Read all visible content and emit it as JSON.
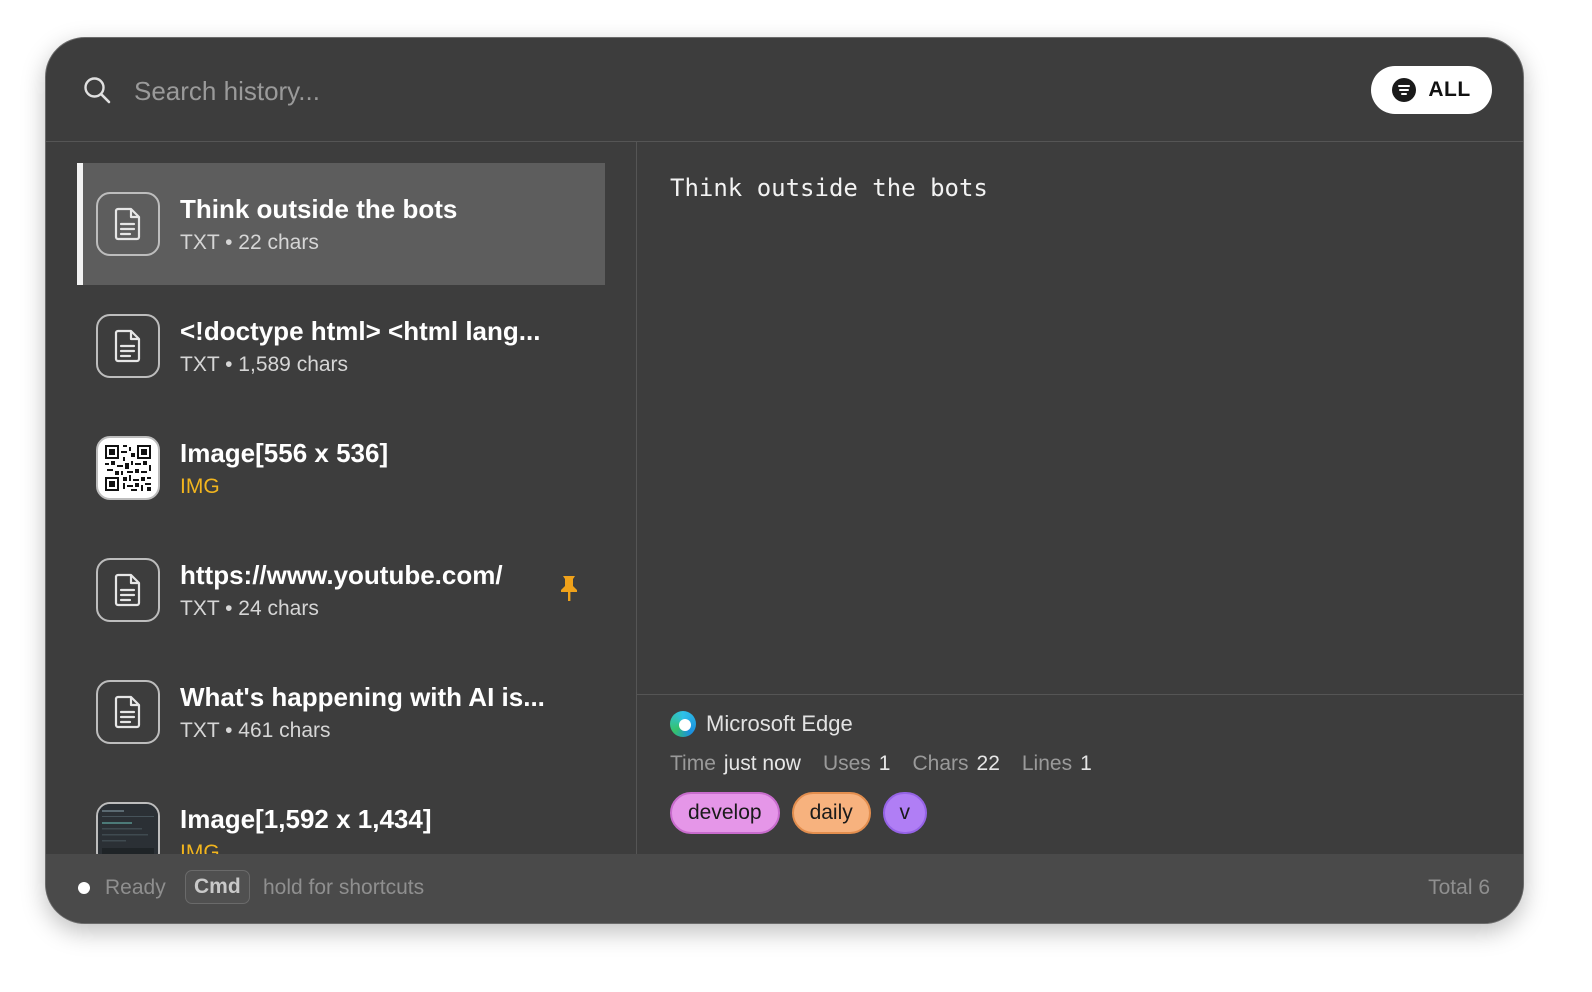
{
  "search": {
    "placeholder": "Search history..."
  },
  "filter": {
    "label": "ALL"
  },
  "items": [
    {
      "title": "Think outside the bots",
      "type": "TXT",
      "detail": "22 chars",
      "meta": "TXT • 22 chars",
      "kind": "text",
      "selected": true,
      "pinned": false
    },
    {
      "title": "<!doctype html> <html lang...",
      "type": "TXT",
      "detail": "1,589 chars",
      "meta": "TXT • 1,589 chars",
      "kind": "text",
      "selected": false,
      "pinned": false
    },
    {
      "title": "Image[556 x 536]",
      "type": "IMG",
      "meta": "IMG",
      "kind": "image-qr",
      "selected": false,
      "pinned": false
    },
    {
      "title": "https://www.youtube.com/",
      "type": "TXT",
      "detail": "24 chars",
      "meta": "TXT • 24 chars",
      "kind": "text",
      "selected": false,
      "pinned": true
    },
    {
      "title": "What's happening with AI is...",
      "type": "TXT",
      "detail": "461 chars",
      "meta": "TXT • 461 chars",
      "kind": "text",
      "selected": false,
      "pinned": false
    },
    {
      "title": "Image[1,592 x 1,434]",
      "type": "IMG",
      "meta": "IMG",
      "kind": "image-screenshot",
      "selected": false,
      "pinned": false
    }
  ],
  "preview": {
    "content": "Think outside the bots"
  },
  "details": {
    "source": "Microsoft Edge",
    "source_icon": "edge-browser-icon",
    "stats": [
      {
        "label": "Time",
        "value": "just now"
      },
      {
        "label": "Uses",
        "value": "1"
      },
      {
        "label": "Chars",
        "value": "22"
      },
      {
        "label": "Lines",
        "value": "1"
      }
    ],
    "tags": [
      {
        "label": "develop",
        "color": "#e596e8"
      },
      {
        "label": "daily",
        "color": "#f7b27e"
      },
      {
        "label": "v",
        "color": "#b07ef5"
      }
    ]
  },
  "status": {
    "state": "Ready",
    "key": "Cmd",
    "hint": "hold for shortcuts",
    "total": "Total 6"
  },
  "colors": {
    "window_bg": "#3d3d3d",
    "selected_bg": "#5d5d5d",
    "img_label": "#f2b51e",
    "pin": "#f0a21a"
  }
}
